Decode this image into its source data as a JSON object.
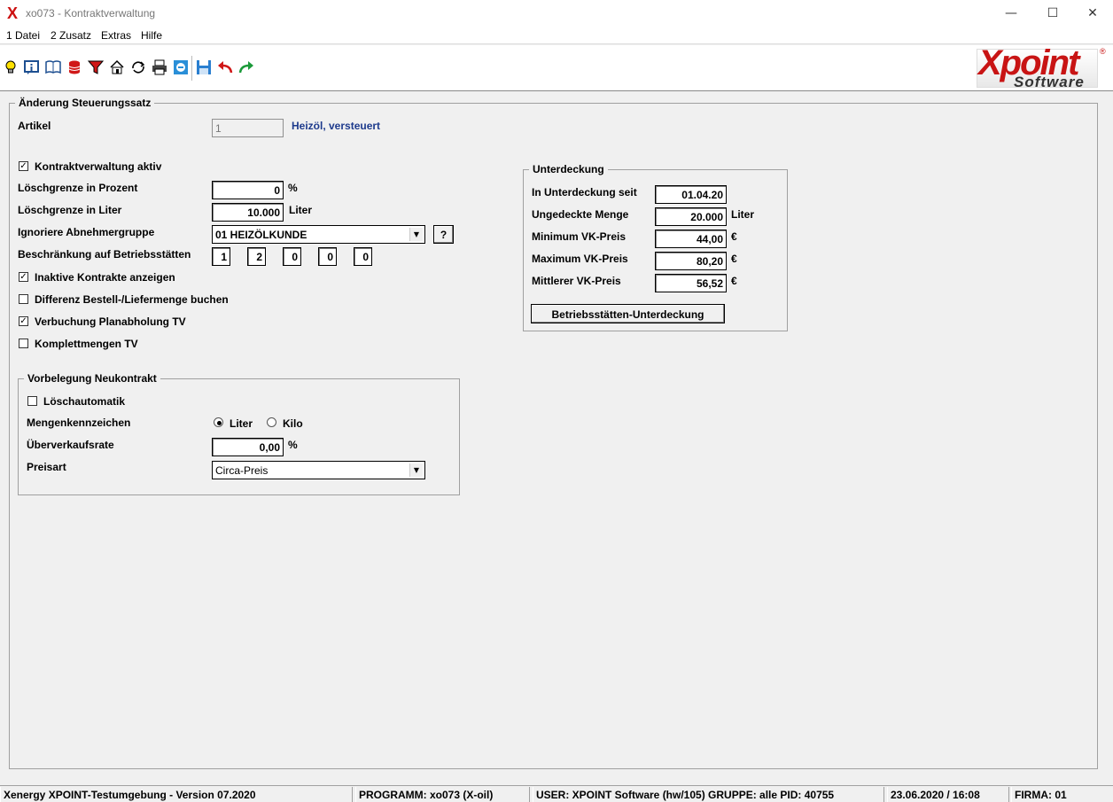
{
  "window": {
    "app_logo": "X",
    "title": "xo073 - Kontraktverwaltung",
    "minimize": "—",
    "maximize": "☐",
    "close": "✕"
  },
  "menu": [
    "1 Datei",
    "2 Zusatz",
    "Extras",
    "Hilfe"
  ],
  "toolbar": {
    "icons": [
      "lightbulb-icon",
      "info-icon",
      "book-icon",
      "database-icon",
      "filter-icon",
      "home-icon",
      "refresh-icon",
      "print-icon",
      "minus-circle-icon",
      "save-icon",
      "undo-icon",
      "redo-icon"
    ],
    "brand_top": "Xpoint",
    "brand_bottom": "Software",
    "brand_reg": "®"
  },
  "main": {
    "group_title": "Änderung Steuerungssatz",
    "artikel": {
      "label": "Artikel",
      "value": "1",
      "desc": "Heizöl, versteuert"
    },
    "kontrakt_aktiv": {
      "label": "Kontraktverwaltung aktiv",
      "checked": true
    },
    "loeschgrenze_prozent": {
      "label": "Löschgrenze in Prozent",
      "value": "0",
      "unit": "%"
    },
    "loeschgrenze_liter": {
      "label": "Löschgrenze in Liter",
      "value": "10.000",
      "unit": "Liter"
    },
    "abnehmergruppe": {
      "label": "Ignoriere Abnehmergruppe",
      "value": "01  HEIZÖLKUNDE",
      "help": "?"
    },
    "betriebsstaetten": {
      "label": "Beschränkung auf Betriebsstätten",
      "values": [
        "1",
        "2",
        "0",
        "0",
        "0"
      ]
    },
    "inaktive": {
      "label": "Inaktive Kontrakte anzeigen",
      "checked": true
    },
    "differenz": {
      "label": "Differenz Bestell-/Liefermenge buchen",
      "checked": false
    },
    "verbuchung": {
      "label": "Verbuchung Planabholung TV",
      "checked": true
    },
    "komplett": {
      "label": "Komplettmengen TV",
      "checked": false
    }
  },
  "vorbelegung": {
    "title": "Vorbelegung Neukontrakt",
    "loeschautomatik": {
      "label": "Löschautomatik",
      "checked": false
    },
    "mengen": {
      "label": "Mengenkennzeichen",
      "opt1": "Liter",
      "opt2": "Kilo",
      "selected": "Liter"
    },
    "ueberverkauf": {
      "label": "Überverkaufsrate",
      "value": "0,00",
      "unit": "%"
    },
    "preisart": {
      "label": "Preisart",
      "value": "Circa-Preis"
    }
  },
  "unterdeckung": {
    "title": "Unterdeckung",
    "seit": {
      "label": "In Unterdeckung seit",
      "value": "01.04.20"
    },
    "menge": {
      "label": "Ungedeckte Menge",
      "value": "20.000",
      "unit": "Liter"
    },
    "min": {
      "label": "Minimum VK-Preis",
      "value": "44,00",
      "unit": "€"
    },
    "max": {
      "label": "Maximum VK-Preis",
      "value": "80,20",
      "unit": "€"
    },
    "mittel": {
      "label": "Mittlerer VK-Preis",
      "value": "56,52",
      "unit": "€"
    },
    "button": "Betriebsstätten-Unterdeckung"
  },
  "status": {
    "env": "Xenergy XPOINT-Testumgebung - Version 07.2020",
    "programm": "PROGRAMM: xo073 (X-oil)",
    "user": "USER: XPOINT Software (hw/105)  GRUPPE: alle  PID: 40755",
    "datetime": "23.06.2020 / 16:08",
    "firma": "FIRMA: 01"
  }
}
